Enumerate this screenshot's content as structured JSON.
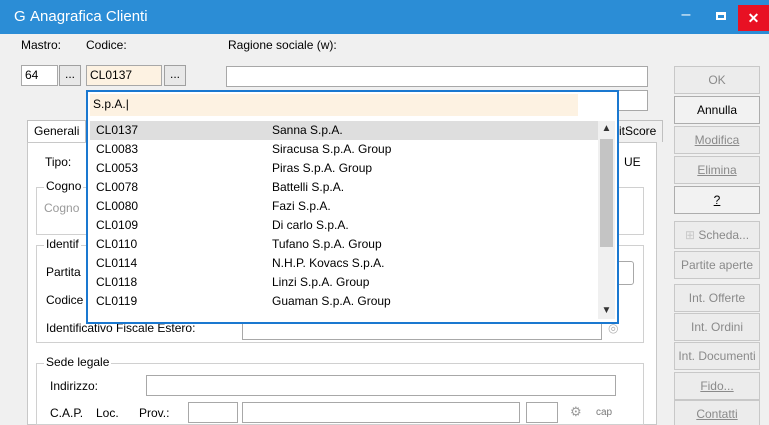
{
  "window": {
    "title": "Anagrafica Clienti",
    "app_icon": "G",
    "minimize": "–",
    "close": "✕"
  },
  "header": {
    "mastro_label": "Mastro:",
    "codice_label": "Codice:",
    "ragione_label": "Ragione sociale (w):",
    "mastro_value": "64",
    "codice_value": "CL0137",
    "browse": "..."
  },
  "tabs": {
    "generali": "Generali",
    "creditscore": "itScore"
  },
  "form": {
    "tipo_label": "Tipo:",
    "ue_label": "UE",
    "cogno_group": "Cogno",
    "cogno_placeholder": "Cogno",
    "identif_group": "Identif",
    "partita_label": "Partita",
    "codice_label": "Codice",
    "id_fiscale_label": "Identificativo Fiscale Estero:",
    "sede_group": "Sede legale",
    "indirizzo_label": "Indirizzo:",
    "cap_label": "C.A.P.",
    "loc_label": "Loc.",
    "prov_label": "Prov.:",
    "cap_link": "cap"
  },
  "buttons": {
    "ok": "OK",
    "annulla": "Annulla",
    "modifica": "Modifica",
    "elimina": "Elimina",
    "help": "?",
    "scheda": "Scheda...",
    "partite": "Partite aperte",
    "offerte": "Int. Offerte",
    "ordini": "Int. Ordini",
    "documenti": "Int. Documenti",
    "fido": "Fido...",
    "contatti": "Contatti"
  },
  "dropdown": {
    "search_value": "S.p.A.",
    "rows": [
      {
        "code": "CL0137",
        "name": "Sanna S.p.A."
      },
      {
        "code": "CL0083",
        "name": "Siracusa S.p.A. Group"
      },
      {
        "code": "CL0053",
        "name": "Piras S.p.A. Group"
      },
      {
        "code": "CL0078",
        "name": "Battelli S.p.A."
      },
      {
        "code": "CL0080",
        "name": "Fazi S.p.A."
      },
      {
        "code": "CL0109",
        "name": "Di carlo S.p.A."
      },
      {
        "code": "CL0110",
        "name": "Tufano S.p.A. Group"
      },
      {
        "code": "CL0114",
        "name": "N.H.P. Kovacs S.p.A."
      },
      {
        "code": "CL0118",
        "name": "Linzi S.p.A. Group"
      },
      {
        "code": "CL0119",
        "name": "Guaman S.p.A. Group"
      }
    ]
  }
}
